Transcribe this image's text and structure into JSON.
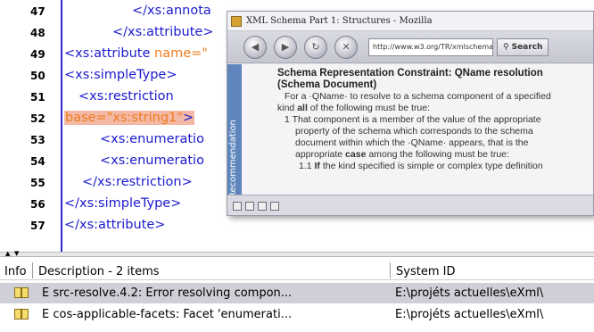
{
  "editor": {
    "lines": [
      {
        "num": "47",
        "code": "</xs:annota"
      },
      {
        "num": "48",
        "code": "</xs:attribute>"
      },
      {
        "num": "49",
        "code": "<xs:attribute ",
        "attr": "name=\""
      },
      {
        "num": "50",
        "code": "<xs:simpleType>"
      },
      {
        "num": "51",
        "code": "<xs:restriction"
      },
      {
        "num": "52",
        "code_attr": "base=\"xs:string1\"",
        "code_close": ">"
      },
      {
        "num": "53",
        "code": "<xs:enumeratio"
      },
      {
        "num": "54",
        "code": "<xs:enumeratio"
      },
      {
        "num": "55",
        "code": "</xs:restriction>"
      },
      {
        "num": "56",
        "code": "</xs:simpleType>"
      },
      {
        "num": "57",
        "code": "</xs:attribute>"
      }
    ]
  },
  "browser": {
    "title": "XML Schema Part 1: Structures - Mozilla",
    "url": "http://www.w3.org/TR/xmlschema-1/",
    "search_label": "Search",
    "side_label": "Recommendation",
    "content": {
      "heading1": "Schema Representation Constraint: QName resolution",
      "heading2": "(Schema Document)",
      "l1": "For a ·QName· to resolve to a schema component of a specified",
      "l2a": "kind ",
      "l2b": "all",
      "l2c": " of the following must be true:",
      "l3": "1 That component is a member of the value of the appropriate",
      "l4": "property of the schema which corresponds to the schema",
      "l5": "document within which the ·QName· appears, that is the",
      "l6a": "appropriate ",
      "l6b": "case",
      "l6c": " among the following must be true:",
      "l7a": "1.1 ",
      "l7b": "If",
      "l7c": " the kind specified is simple or complex type definition"
    }
  },
  "panel": {
    "col_info": "Info",
    "col_description": "Description - 2 items",
    "col_system": "System ID",
    "rows": [
      {
        "description": "E src-resolve.4.2: Error resolving compon...",
        "system": "E:\\projéts actuelles\\eXml\\",
        "selected": true
      },
      {
        "description": "E cos-applicable-facets: Facet 'enumerati...",
        "system": "E:\\projéts actuelles\\eXml\\",
        "selected": false
      }
    ]
  }
}
